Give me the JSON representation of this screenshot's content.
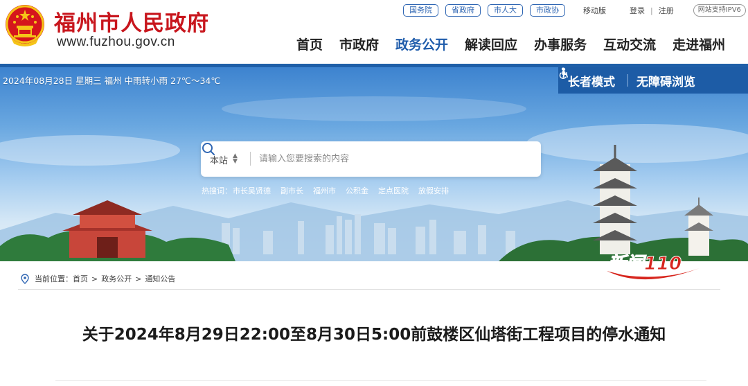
{
  "header": {
    "site_name": "福州市人民政府",
    "site_domain": "www.fuzhou.gov.cn",
    "gov_links": [
      "国务院",
      "省政府",
      "市人大",
      "市政协"
    ],
    "mobile_label": "移动版",
    "login_label": "登录",
    "register_label": "注册",
    "ipv6_label": "网站支持IPV6"
  },
  "nav": {
    "items": [
      "首页",
      "市政府",
      "政务公开",
      "解读回应",
      "办事服务",
      "互动交流",
      "走进福州"
    ],
    "active_index": 2
  },
  "banner": {
    "weather": "2024年08月28日 星期三  福州 中雨转小雨 27℃～34℃",
    "elder_mode": "长者模式",
    "accessible": "无障碍浏览",
    "search": {
      "scope": "本站",
      "placeholder": "请输入您要搜索的内容"
    },
    "hot": {
      "label": "热搜词：",
      "items": [
        "市长吴贤德",
        "副市长",
        "福州市",
        "公积金",
        "定点医院",
        "放假安排"
      ]
    }
  },
  "breadcrumb": {
    "label": "当前位置：",
    "items": [
      "首页",
      "政务公开",
      "通知公告"
    ]
  },
  "news_logo_text": "新闻110",
  "article": {
    "title": "关于2024年8月29日22:00至8月30日5:00前鼓楼区仙塔街工程项目的停水通知"
  },
  "colors": {
    "brand_red": "#c8161d",
    "nav_blue": "#1f5cab",
    "bar_blue": "#1d5ca6"
  },
  "icons": {
    "emblem": "national-emblem-icon",
    "elder": "elder-person-icon",
    "accessible": "wheelchair-icon",
    "search": "search-icon",
    "location": "location-pin-icon"
  }
}
